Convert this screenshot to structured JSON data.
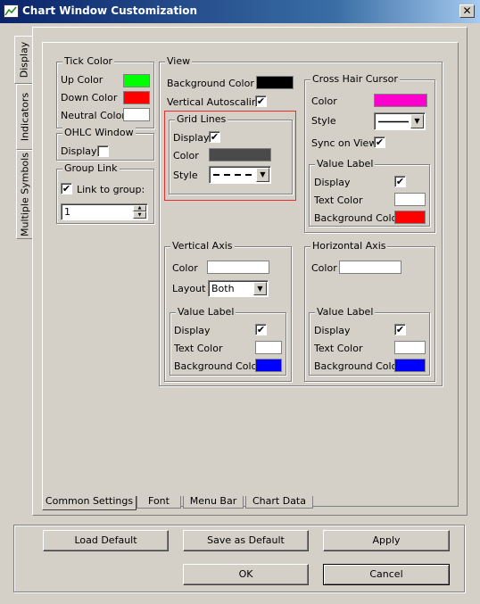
{
  "window": {
    "title": "Chart Window Customization",
    "close": "✕"
  },
  "side_tabs": [
    "Display",
    "Indicators",
    "Multiple Symbols"
  ],
  "bottom_tabs": [
    "Common Settings",
    "Font",
    "Menu Bar",
    "Chart Data"
  ],
  "tick_color": {
    "title": "Tick Color",
    "up": "Up Color",
    "down": "Down Color",
    "neutral": "Neutral Color",
    "up_color": "#00ff00",
    "down_color": "#ff0000",
    "neutral_color": "#ffffff"
  },
  "ohlc": {
    "title": "OHLC Window",
    "display": "Display"
  },
  "group_link": {
    "title": "Group Link",
    "link": "Link to group:",
    "value": "1"
  },
  "view": {
    "title": "View",
    "bg_label": "Background Color",
    "bg_color": "#000000",
    "vscale": "Vertical Autoscaling"
  },
  "grid": {
    "title": "Grid Lines",
    "display": "Display",
    "color": "Color",
    "style": "Style",
    "color_value": "#4a4a4a"
  },
  "crosshair": {
    "title": "Cross Hair Cursor",
    "color": "Color",
    "style": "Style",
    "sync": "Sync on View",
    "color_value": "#ff00cc",
    "value_label": {
      "title": "Value Label",
      "display": "Display",
      "text": "Text Color",
      "bg": "Background Color",
      "text_value": "#ffffff",
      "bg_value": "#ff0000"
    }
  },
  "vaxis": {
    "title": "Vertical Axis",
    "color": "Color",
    "layout": "Layout",
    "layout_value": "Both",
    "color_value": "#ffffff",
    "value_label": {
      "title": "Value Label",
      "display": "Display",
      "text": "Text Color",
      "bg": "Background Color",
      "text_value": "#ffffff",
      "bg_value": "#0000ff"
    }
  },
  "haxis": {
    "title": "Horizontal Axis",
    "color": "Color",
    "color_value": "#ffffff",
    "value_label": {
      "title": "Value Label",
      "display": "Display",
      "text": "Text Color",
      "bg": "Background Color",
      "text_value": "#ffffff",
      "bg_value": "#0000ff"
    }
  },
  "buttons": {
    "load": "Load Default",
    "save": "Save as Default",
    "apply": "Apply",
    "ok": "OK",
    "cancel": "Cancel"
  },
  "check": "✔",
  "arrows": {
    "down": "▼",
    "up": "▲"
  }
}
